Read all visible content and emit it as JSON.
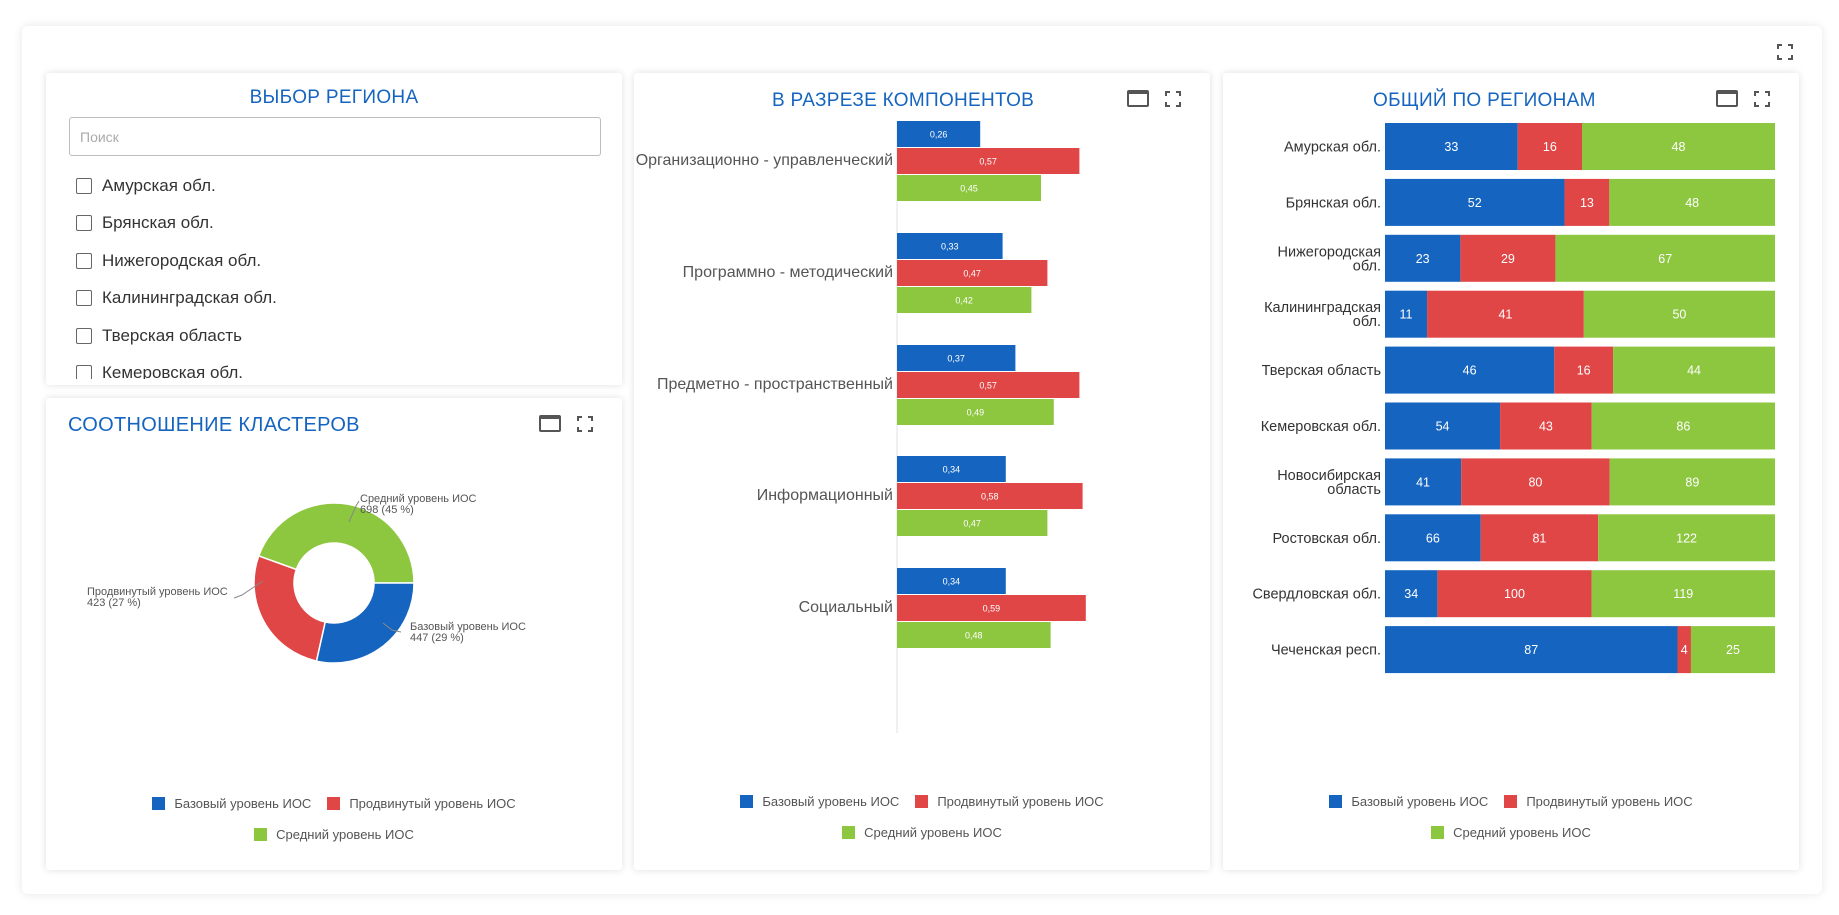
{
  "colors": {
    "base": "#1565c0",
    "advanced": "#e04646",
    "medium": "#8dc63f",
    "title": "#1565c0"
  },
  "legend": {
    "base": "Базовый уровень ИОС",
    "advanced": "Продвинутый уровень ИОС",
    "medium": "Средний уровень ИОС"
  },
  "region_panel": {
    "title": "ВЫБОР РЕГИОНА",
    "search_placeholder": "Поиск",
    "items": [
      {
        "label": "Амурская обл."
      },
      {
        "label": "Брянская обл."
      },
      {
        "label": "Нижегородская обл."
      },
      {
        "label": "Калининградская обл."
      },
      {
        "label": "Тверская область"
      },
      {
        "label": "Кемеровская обл."
      }
    ]
  },
  "cluster_panel": {
    "title": "СООТНОШЕНИЕ КЛАСТЕРОВ",
    "labels": {
      "medium_name": "Средний уровень ИОС",
      "medium_value": "698  (45 %)",
      "advanced_name": "Продвинутый уровень ИОС",
      "advanced_value": "423  (27 %)",
      "base_name": "Базовый уровень ИОС",
      "base_value": "447  (29 %)"
    }
  },
  "components_panel": {
    "title": "В РАЗРЕЗЕ КОМПОНЕНТОВ"
  },
  "regions_panel": {
    "title": "ОБЩИЙ ПО РЕГИОНАМ"
  },
  "chart_data": [
    {
      "type": "pie",
      "title": "СООТНОШЕНИЕ КЛАСТЕРОВ",
      "categories": [
        "Средний уровень ИОС",
        "Продвинутый уровень ИОС",
        "Базовый уровень ИОС"
      ],
      "values": [
        698,
        423,
        447
      ],
      "percent": [
        45,
        27,
        29
      ]
    },
    {
      "type": "bar",
      "orientation": "horizontal",
      "title": "В РАЗРЕЗЕ КОМПОНЕНТОВ",
      "categories": [
        "Организационно - управленческий",
        "Программно - методический",
        "Предметно - пространственный",
        "Информационный",
        "Социальный"
      ],
      "series": [
        {
          "name": "Базовый уровень ИОС",
          "values": [
            0.26,
            0.33,
            0.37,
            0.34,
            0.34
          ],
          "labels": [
            "0,26",
            "0,33",
            "0,37",
            "0,34",
            "0,34"
          ]
        },
        {
          "name": "Продвинутый уровень ИОС",
          "values": [
            0.57,
            0.47,
            0.57,
            0.58,
            0.59
          ],
          "labels": [
            "0,57",
            "0,47",
            "0,57",
            "0,58",
            "0,59"
          ]
        },
        {
          "name": "Средний уровень ИОС",
          "values": [
            0.45,
            0.42,
            0.49,
            0.47,
            0.48
          ],
          "labels": [
            "0,45",
            "0,42",
            "0,49",
            "0,47",
            "0,48"
          ]
        }
      ],
      "xlim": [
        0,
        0.6
      ]
    },
    {
      "type": "bar",
      "orientation": "horizontal",
      "stacked": "percent",
      "title": "ОБЩИЙ ПО РЕГИОНАМ",
      "categories": [
        [
          "Амурская обл."
        ],
        [
          "Брянская обл."
        ],
        [
          "Нижегородская",
          "обл."
        ],
        [
          "Калининградская",
          "обл."
        ],
        [
          "Тверская область"
        ],
        [
          "Кемеровская обл."
        ],
        [
          "Новосибирская",
          "область"
        ],
        [
          "Ростовская обл."
        ],
        [
          "Свердловская обл."
        ],
        [
          "Чеченская респ."
        ]
      ],
      "series": [
        {
          "name": "Базовый уровень ИОС",
          "values": [
            33,
            52,
            23,
            11,
            46,
            54,
            41,
            66,
            34,
            87
          ]
        },
        {
          "name": "Продвинутый уровень ИОС",
          "values": [
            16,
            13,
            29,
            41,
            16,
            43,
            80,
            81,
            100,
            4
          ]
        },
        {
          "name": "Средний уровень ИОС",
          "values": [
            48,
            48,
            67,
            50,
            44,
            86,
            89,
            122,
            119,
            25
          ]
        }
      ]
    }
  ]
}
